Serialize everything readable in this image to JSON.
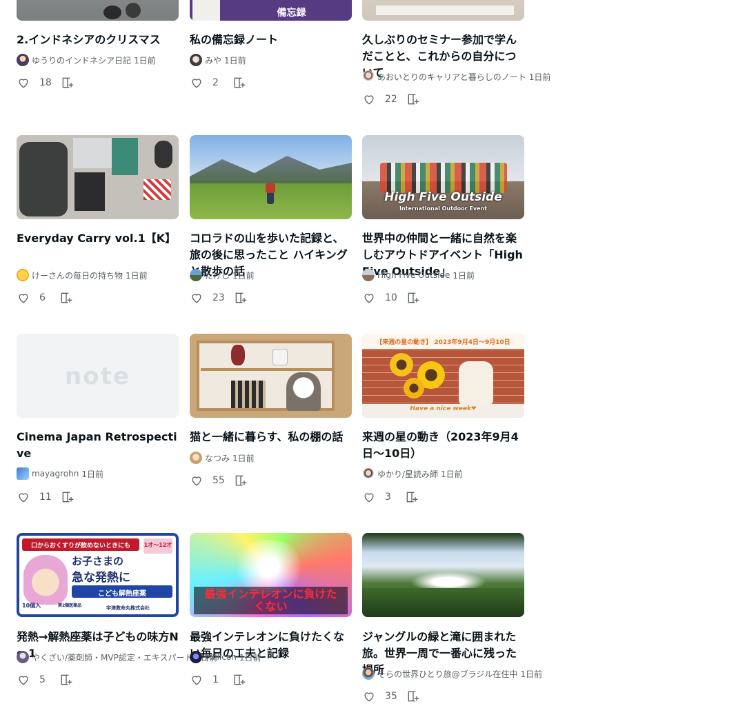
{
  "rows": [
    [
      {
        "title": "2.インドネシアのクリスマス",
        "author": "ゆうりのインドネシア日記",
        "ago": "1日前",
        "likes": "18"
      },
      {
        "title": "私の備忘録ノート",
        "author": "みや",
        "ago": "1日前",
        "likes": "2"
      },
      {
        "title": "久しぶりのセミナー参加で学んだことと、これからの自分について",
        "author": "あおいとりのキャリアと暮らしのノート",
        "ago": "1日前",
        "likes": "22"
      }
    ],
    [
      {
        "title": "Everyday Carry vol.1【K】",
        "author": "けーさんの毎日の持ち物",
        "ago": "1日前",
        "likes": "6"
      },
      {
        "title": "コロラドの山を歩いた記録と、旅の後に思ったこと ハイキングと散歩の話",
        "author": "たけし",
        "ago": "1日前",
        "likes": "23"
      },
      {
        "title": "世界中の仲間と一緒に自然を楽しむアウトドアイベント「High Five Outside」",
        "author": "High Five Outside",
        "ago": "1日前",
        "likes": "10"
      }
    ],
    [
      {
        "title": "Cinema Japan Retrospective",
        "author": "mayagrohn",
        "ago": "1日前",
        "likes": "11"
      },
      {
        "title": "猫と一緒に暮らす、私の棚の話",
        "author": "なつみ",
        "ago": "1日前",
        "likes": "55"
      },
      {
        "title": "来週の星の動き（2023年9月4日〜10日）",
        "author": "ゆかり/星読み師",
        "ago": "1日前",
        "likes": "3"
      }
    ],
    [
      {
        "title": "発熱→解熱座薬は子どもの味方No.1",
        "author": "やくざい/薬剤師・MVP認定・エキスパート",
        "ago": "1日前",
        "likes": "5"
      },
      {
        "title": "最強インテレオンに負けたくない毎日の工夫と記録",
        "author": "Pxilicon",
        "ago": "1日前",
        "likes": "1"
      },
      {
        "title": "ジャングルの緑と滝に囲まれた旅。世界一周で一番心に残った場所",
        "author": "そらの世界ひとり旅@ブラジル在住中",
        "ago": "1日前",
        "likes": "35"
      }
    ]
  ],
  "thumb_text": {
    "r0c1": "備忘録",
    "r1c2_main": "High Five Outside",
    "r1c2_sub": "International Outdoor Event",
    "r2c0": "note",
    "r2c2_top": "【来週の星の動き】 2023年9月4日～9月10日",
    "r2c2_bottom": "Have a nice week❤",
    "r3c0_top": "口からおくすりが飲めないときにも",
    "r3c0_age": "1才～12才",
    "r3c0_main1": "お子さまの",
    "r3c0_main2": "急な発熱に",
    "r3c0_sub": "こども解熱座薬",
    "r3c0_count": "10個入",
    "r3c0_class": "第2類医薬品",
    "r3c0_maker": "宇津救命丸株式会社",
    "r3c1": "最強インテレオンに負けたくない"
  },
  "colors": {
    "text": "#08131a",
    "meta": "#5a6166",
    "icon": "#5a6166"
  }
}
